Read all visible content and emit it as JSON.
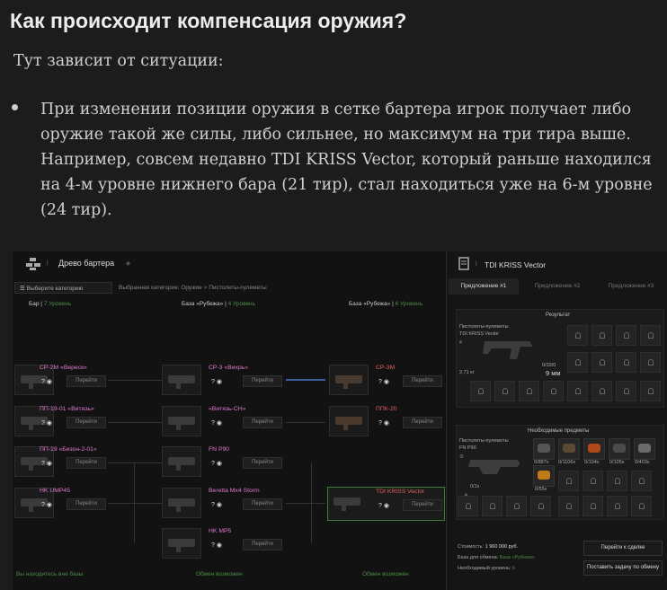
{
  "article": {
    "heading": "Как происходит компенсация оружия?",
    "intro": "Тут зависит от ситуации:",
    "bullet": "При изменении позиции оружия в сетке бартера игрок получает либо оружие такой же силы, либо сильнее, но максимум на три тира выше. Например, совсем недавно TDI KRISS Vector, который раньше находился на 4-м уровне нижнего бара (21 тир), стал находиться уже на 6-м уровне (24 тир)."
  },
  "game": {
    "left": {
      "title": "Древо бартера",
      "category_button": "Выберите категорию",
      "selected_category": "Выбранная категория: Оружие > Пистолеты-пулеметы",
      "columns": [
        {
          "name": "Бар",
          "sep": " | ",
          "level": "7 Уровень"
        },
        {
          "name": "База «Рубежа»",
          "sep": " | ",
          "level": "4 Уровень"
        },
        {
          "name": "База «Рубежа»",
          "sep": " | ",
          "level": "6 Уровень"
        }
      ],
      "col1": [
        "СР-2М «Вереск»",
        "ПП-19-01 «Витязь»",
        "ПП-19 «Бизон-2-01»",
        "HK UMP45"
      ],
      "col2": [
        "СР-3 «Вихрь»",
        "«Витязь-СН»",
        "FN P90",
        "Beretta Mx4 Storm",
        "HK MP5"
      ],
      "col3": [
        "СР-3М",
        "ППК-20",
        "TDI KRISS Vector"
      ],
      "q_mark": "?",
      "go_label": "Перейти",
      "footer_col1": "Вы находитесь вне базы",
      "footer_col2": "Обмен возможен",
      "footer_col3": "Обмен возможен"
    },
    "right": {
      "title": "TDI KRISS Vector",
      "tabs": [
        "Предложение #1",
        "Предложение #2",
        "Предложение #3"
      ],
      "result_title": "Результат",
      "result_category": "Пистолеты-пулеметы",
      "result_name": "TDI KRISS Vector",
      "weight": "2,71 кг",
      "ammo": "0/33/0",
      "caliber": "9 мм",
      "needed_title": "Необходимые предметы",
      "needed_category": "Пистолеты-пулеметы",
      "needed_name": "FN P90",
      "needed_count": "0/1x",
      "items": [
        "0/887x",
        "0/1106x",
        "0/104x",
        "0/105x",
        "0/403x"
      ],
      "extra_item": "0/55x",
      "cost_label": "Стоимость:",
      "cost_value": "1 960 000 руб.",
      "base_label": "База для обмена:",
      "base_value": "База «Рубежа»",
      "level_label": "Необходимый уровень:",
      "level_value": "6",
      "btn_go": "Перейти к сделке",
      "btn_task": "Поставить задачу по обмену",
      "colors": {
        "accent_green": "#4e8b46",
        "pink": "#e17ad0",
        "red": "#e35e5e"
      }
    }
  }
}
